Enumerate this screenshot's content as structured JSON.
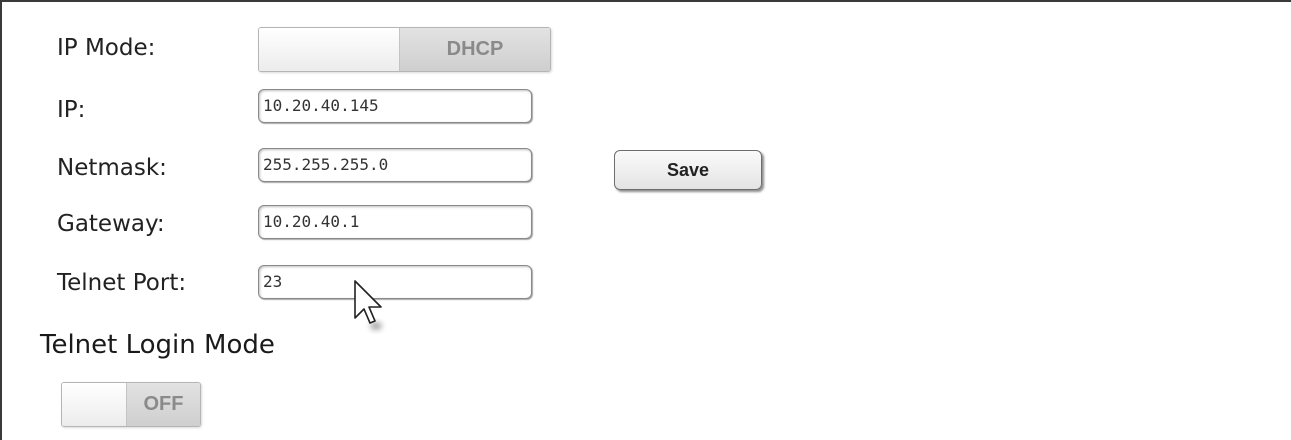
{
  "network": {
    "ip_mode_label": "IP Mode:",
    "ip_mode_value": "DHCP",
    "ip_label": "IP:",
    "ip_value": "10.20.40.145",
    "netmask_label": "Netmask:",
    "netmask_value": "255.255.255.0",
    "gateway_label": "Gateway:",
    "gateway_value": "10.20.40.1",
    "telnet_port_label": "Telnet Port:",
    "telnet_port_value": "23",
    "save_label": "Save"
  },
  "telnet_login": {
    "heading": "Telnet Login Mode",
    "toggle_value": "OFF"
  },
  "icons": {
    "cursor": "mouse-pointer-icon"
  },
  "colors": {
    "toggle_off_text": "#8a8a8a",
    "frame": "#3a3a3a"
  }
}
